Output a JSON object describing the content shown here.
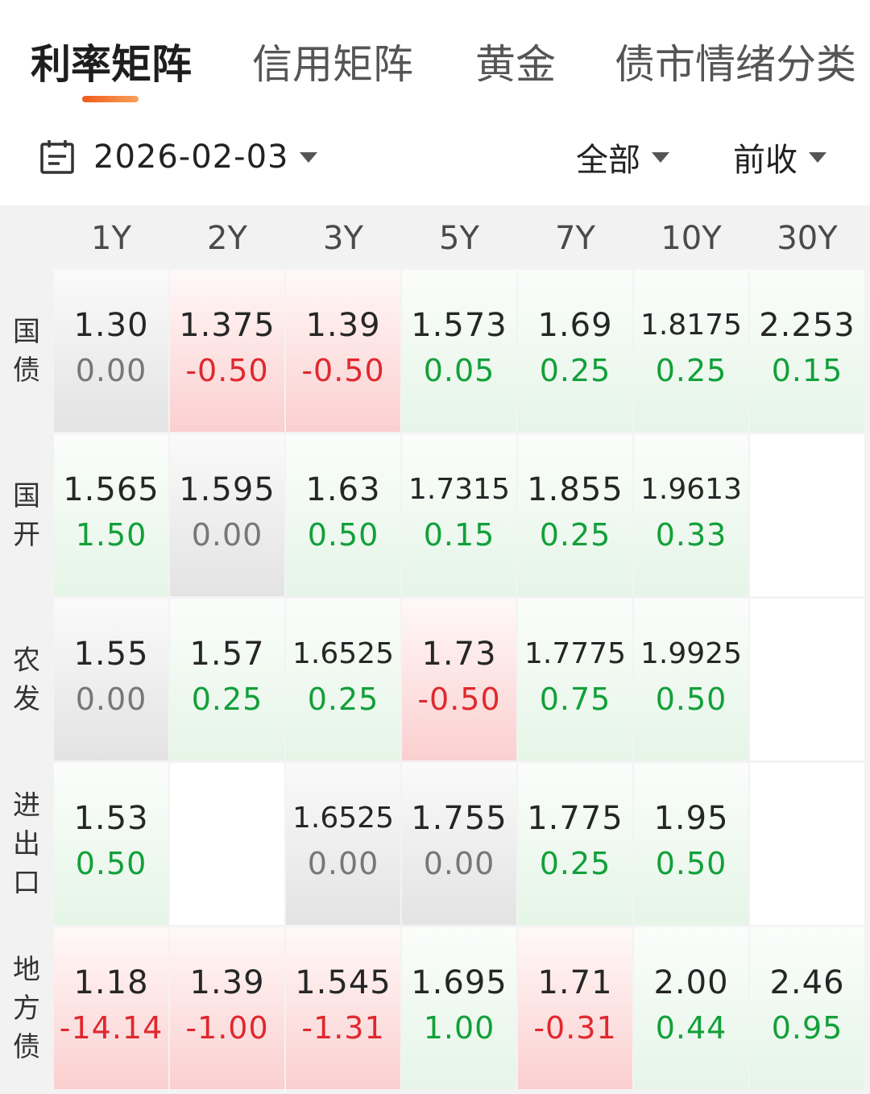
{
  "tabs": [
    {
      "label": "利率矩阵",
      "active": true
    },
    {
      "label": "信用矩阵",
      "active": false
    },
    {
      "label": "黄金",
      "active": false
    },
    {
      "label": "债市情绪分类",
      "active": false
    }
  ],
  "filters": {
    "date": "2026-02-03",
    "scope": "全部",
    "compare": "前收"
  },
  "colors": {
    "accent": "#f05a1a",
    "up_text": "#12a03a",
    "down_text": "#e0282e",
    "flat_text": "#777777"
  },
  "matrix": {
    "columns": [
      "1Y",
      "2Y",
      "3Y",
      "5Y",
      "7Y",
      "10Y",
      "30Y"
    ],
    "rows": [
      {
        "label": [
          "国",
          "债"
        ],
        "cells": [
          {
            "yield": "1.30",
            "change": "0.00",
            "trend": "flat"
          },
          {
            "yield": "1.375",
            "change": "-0.50",
            "trend": "down"
          },
          {
            "yield": "1.39",
            "change": "-0.50",
            "trend": "down"
          },
          {
            "yield": "1.573",
            "change": "0.05",
            "trend": "up"
          },
          {
            "yield": "1.69",
            "change": "0.25",
            "trend": "up"
          },
          {
            "yield": "1.8175",
            "change": "0.25",
            "trend": "up"
          },
          {
            "yield": "2.253",
            "change": "0.15",
            "trend": "up"
          }
        ]
      },
      {
        "label": [
          "国",
          "开"
        ],
        "cells": [
          {
            "yield": "1.565",
            "change": "1.50",
            "trend": "up"
          },
          {
            "yield": "1.595",
            "change": "0.00",
            "trend": "flat"
          },
          {
            "yield": "1.63",
            "change": "0.50",
            "trend": "up"
          },
          {
            "yield": "1.7315",
            "change": "0.15",
            "trend": "up"
          },
          {
            "yield": "1.855",
            "change": "0.25",
            "trend": "up"
          },
          {
            "yield": "1.9613",
            "change": "0.33",
            "trend": "up"
          },
          null
        ]
      },
      {
        "label": [
          "农",
          "发"
        ],
        "cells": [
          {
            "yield": "1.55",
            "change": "0.00",
            "trend": "flat"
          },
          {
            "yield": "1.57",
            "change": "0.25",
            "trend": "up"
          },
          {
            "yield": "1.6525",
            "change": "0.25",
            "trend": "up"
          },
          {
            "yield": "1.73",
            "change": "-0.50",
            "trend": "down"
          },
          {
            "yield": "1.7775",
            "change": "0.75",
            "trend": "up"
          },
          {
            "yield": "1.9925",
            "change": "0.50",
            "trend": "up"
          },
          null
        ]
      },
      {
        "label": [
          "进",
          "出",
          "口"
        ],
        "cells": [
          {
            "yield": "1.53",
            "change": "0.50",
            "trend": "up"
          },
          null,
          {
            "yield": "1.6525",
            "change": "0.00",
            "trend": "flat"
          },
          {
            "yield": "1.755",
            "change": "0.00",
            "trend": "flat"
          },
          {
            "yield": "1.775",
            "change": "0.25",
            "trend": "up"
          },
          {
            "yield": "1.95",
            "change": "0.50",
            "trend": "up"
          },
          null
        ]
      },
      {
        "label": [
          "地",
          "方",
          "债"
        ],
        "cells": [
          {
            "yield": "1.18",
            "change": "-14.14",
            "trend": "down"
          },
          {
            "yield": "1.39",
            "change": "-1.00",
            "trend": "down"
          },
          {
            "yield": "1.545",
            "change": "-1.31",
            "trend": "down"
          },
          {
            "yield": "1.695",
            "change": "1.00",
            "trend": "up"
          },
          {
            "yield": "1.71",
            "change": "-0.31",
            "trend": "down"
          },
          {
            "yield": "2.00",
            "change": "0.44",
            "trend": "up"
          },
          {
            "yield": "2.46",
            "change": "0.95",
            "trend": "up"
          }
        ]
      }
    ]
  }
}
